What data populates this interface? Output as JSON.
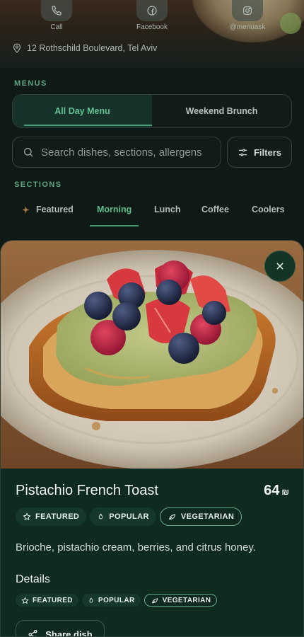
{
  "header": {
    "social": [
      {
        "label": "Call",
        "icon": "phone-icon"
      },
      {
        "label": "Facebook",
        "icon": "facebook-icon"
      },
      {
        "label": "@menuask",
        "icon": "instagram-icon"
      }
    ],
    "address": "12 Rothschild Boulevard, Tel Aviv"
  },
  "menus": {
    "heading": "MENUS",
    "items": [
      {
        "label": "All Day Menu",
        "active": true
      },
      {
        "label": "Weekend Brunch",
        "active": false
      }
    ]
  },
  "search": {
    "placeholder": "Search dishes, sections, allergens",
    "filters_label": "Filters"
  },
  "sections": {
    "heading": "SECTIONS",
    "tabs": [
      {
        "label": "Featured",
        "icon": "sparkle-icon"
      },
      {
        "label": "Morning",
        "active": true
      },
      {
        "label": "Lunch"
      },
      {
        "label": "Coffee"
      },
      {
        "label": "Coolers"
      }
    ]
  },
  "dish": {
    "name": "Pistachio French Toast",
    "price": "64",
    "currency": "₪",
    "tags": [
      "FEATURED",
      "POPULAR",
      "VEGETARIAN"
    ],
    "description": "Brioche, pistachio cream, berries, and citrus honey.",
    "details_heading": "Details",
    "detail_tags": [
      "FEATURED",
      "POPULAR",
      "VEGETARIAN"
    ],
    "share_label": "Share dish"
  },
  "colors": {
    "accent": "#5fbd8c",
    "background": "#0f1a16",
    "card": "#0f2a1f"
  }
}
